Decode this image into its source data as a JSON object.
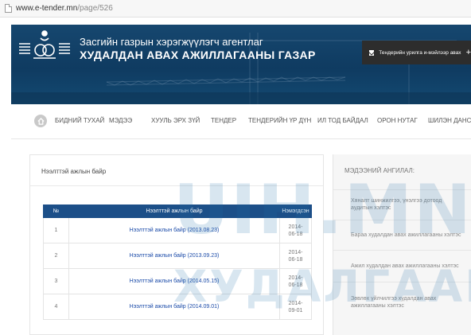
{
  "browser": {
    "url_domain": "www.e-tender.mn",
    "url_path": "/page/526"
  },
  "header": {
    "agency_line1": "Засгийн газрын хэрэгжүүлэгч агентлаг",
    "agency_line2": "ХУДАЛДАН АВАХ АЖИЛЛАГААНЫ ГАЗАР",
    "subscribe_label": "Тендерийн урилга и-мэйлээр авах",
    "subscribe_plus": "+"
  },
  "nav": {
    "items": [
      "БИДНИЙ ТУХАЙ",
      "МЭДЭЭ",
      "ХУУЛЬ ЭРХ ЗҮЙ",
      "ТЕНДЕР",
      "ТЕНДЕРИЙН ҮР ДҮН",
      "ИЛ ТОД БАЙДАЛ",
      "ОРОН НУТАГ",
      "ШИЛЭН ДАНС"
    ]
  },
  "main": {
    "title": "Нээлттэй ажлын байр",
    "table": {
      "headers": [
        "№",
        "Нээлттэй ажлын байр",
        "Нэмэгдсэн"
      ],
      "rows": [
        {
          "no": "1",
          "title": "Нээлттэй ажлын байр (2013.08.23)",
          "date": "2014-06-18"
        },
        {
          "no": "2",
          "title": "Нээлттэй ажлын байр (2013.09.23)",
          "date": "2014-06-18"
        },
        {
          "no": "3",
          "title": "Нээлттэй ажлын байр (2014.05.15)",
          "date": "2014-06-18"
        },
        {
          "no": "4",
          "title": "Нээлттэй ажлын байр (2014.09.01)",
          "date": "2014-09-01"
        }
      ]
    }
  },
  "sidebar": {
    "title": "МЭДЭЭНИЙ АНГИЛАЛ:",
    "items": [
      "Хяналт шинжилгээ, үнэлгээ дотоод аудитын хэлтэс",
      "Бараа худалдан авах ажиллагааны хэлтэс",
      "Ажил худалдан авах ажиллагааны хэлтэс",
      "Зөвлөх үйлчилгээ худалдан авах ажиллагааны хэлтэс"
    ]
  },
  "watermark": {
    "line1": "UIH.MN",
    "line2": "ХУДАЛГААНЫ С"
  },
  "colors": {
    "banner": "#16476f",
    "table_header": "#1c4f88",
    "link": "#1a4aa8",
    "watermark": "#1f6ea9"
  }
}
